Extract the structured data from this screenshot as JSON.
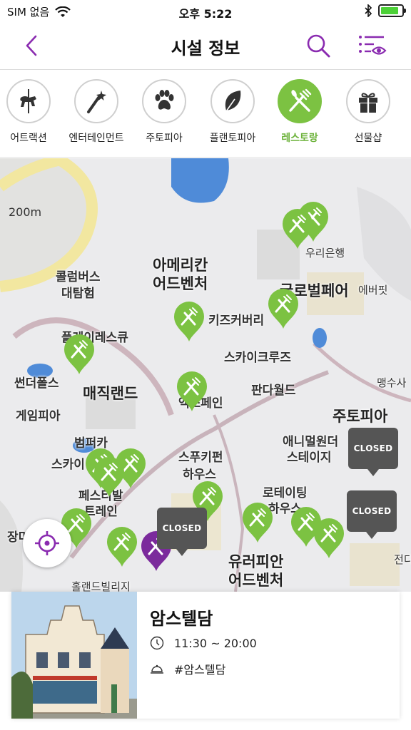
{
  "status": {
    "carrier": "SIM 없음",
    "time": "오후 5:22"
  },
  "header": {
    "title": "시설 정보"
  },
  "categories": [
    {
      "label": "어트랙션",
      "icon": "carousel-horse-icon"
    },
    {
      "label": "엔터테인먼트",
      "icon": "magic-wand-icon"
    },
    {
      "label": "주토피아",
      "icon": "paw-icon"
    },
    {
      "label": "플랜토피아",
      "icon": "leaf-icon"
    },
    {
      "label": "레스토랑",
      "icon": "fork-knife-icon",
      "active": true
    },
    {
      "label": "선물샵",
      "icon": "gift-icon"
    }
  ],
  "map": {
    "scale": "200m",
    "labels": [
      "아메리칸",
      "어드벤처",
      "콜럼버스",
      "대탐험",
      "글로벌페어",
      "에버핏",
      "우리은행",
      "키즈커버리",
      "플레이레스큐",
      "스카이크루즈",
      "썬더폴스",
      "매직랜드",
      "판다월드",
      "맹수사",
      "게임피아",
      "엑스페인",
      "주토피아",
      "범퍼카",
      "스카이",
      "애니멀원더",
      "스테이지",
      "스푸키펀",
      "하우스",
      "페스티발",
      "트레인",
      "로테이팅",
      "하우스",
      "장미",
      "유러피안",
      "어드벤처",
      "홀랜드빌리지",
      "전디"
    ],
    "closed_label": "CLOSED",
    "colors": {
      "pin": "#7cc242",
      "selected_pin": "#7b2a9c",
      "closed": "#555555",
      "accent": "#8a2bb0"
    }
  },
  "selected": {
    "name": "암스텔담",
    "hours": "11:30 ~ 20:00",
    "tag": "#암스텔담"
  }
}
